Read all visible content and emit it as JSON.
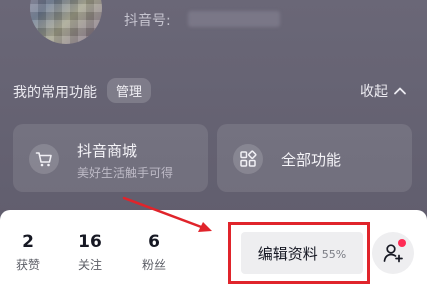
{
  "profile": {
    "id_label": "抖音号:"
  },
  "common_functions": {
    "title": "我的常用功能",
    "manage_label": "管理",
    "collapse_label": "收起",
    "cards": [
      {
        "title": "抖音商城",
        "subtitle": "美好生活触手可得",
        "icon": "cart-icon"
      },
      {
        "title": "全部功能",
        "icon": "grid-icon"
      }
    ]
  },
  "stats": [
    {
      "value": "2",
      "label": "获赞"
    },
    {
      "value": "16",
      "label": "关注"
    },
    {
      "value": "6",
      "label": "粉丝"
    }
  ],
  "edit_profile": {
    "label": "编辑资料",
    "completion": "55%"
  },
  "add_friend": {
    "icon": "add-user-icon",
    "has_notification": true
  },
  "colors": {
    "annotation": "#e0242b",
    "notification_dot": "#fe2c55",
    "background": "#6a6777"
  }
}
